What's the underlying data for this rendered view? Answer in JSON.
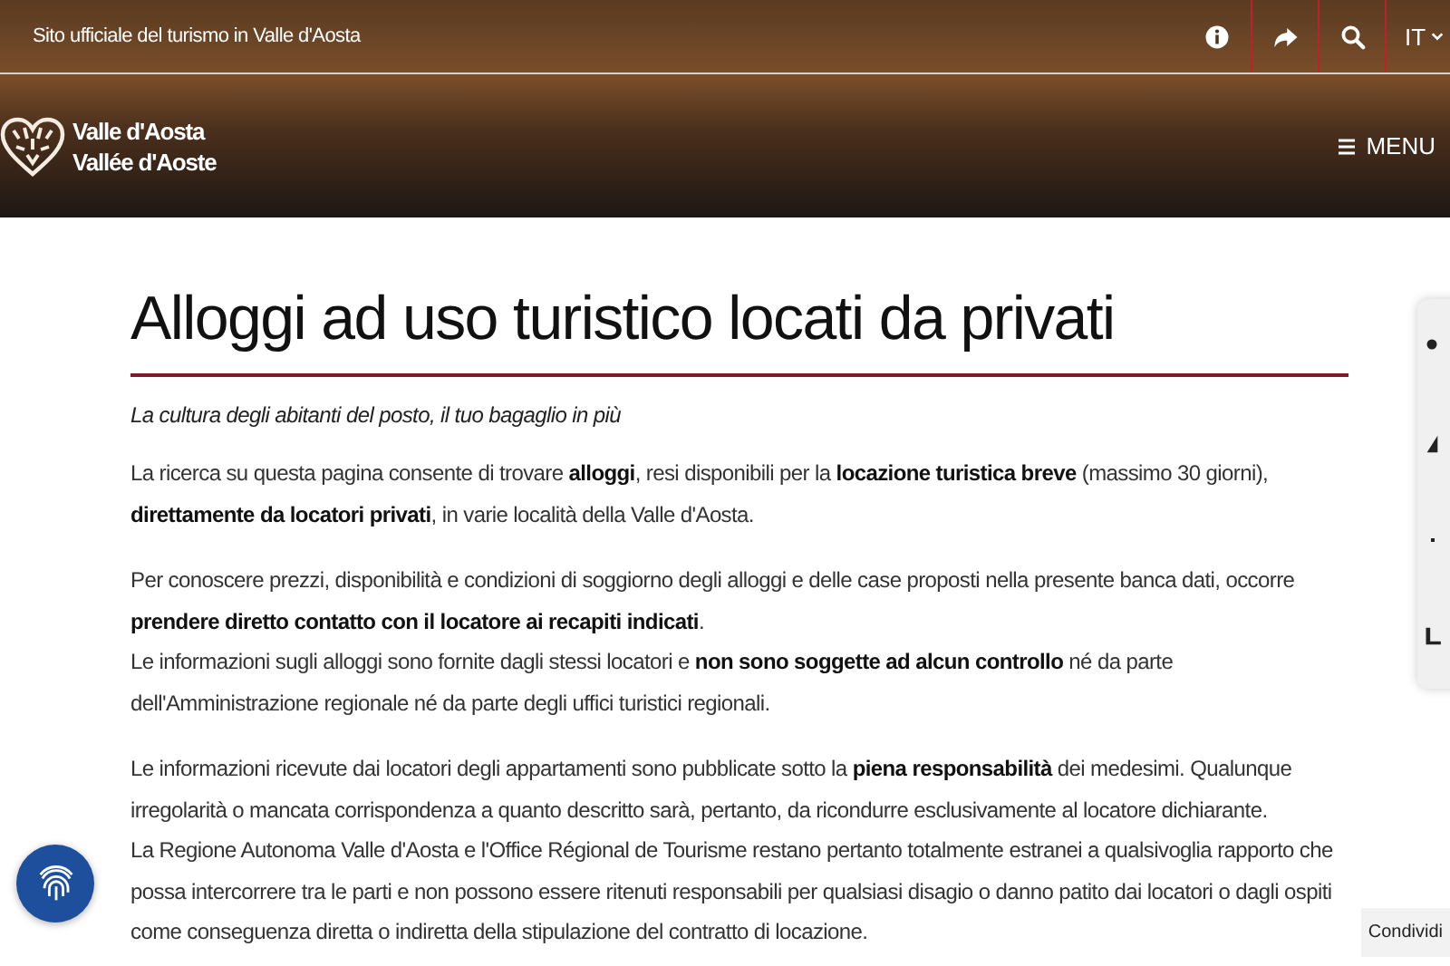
{
  "header": {
    "tagline": "Sito ufficiale del turismo in Valle d'Aosta",
    "language": "IT",
    "logo_lines": [
      "Valle d'Aosta",
      "Vallée d'Aoste"
    ],
    "menu": "MENU"
  },
  "page": {
    "title": "Alloggi ad uso turistico locati da privati",
    "subtitle": "La cultura degli abitanti del posto, il tuo bagaglio in più",
    "sections": [
      [
        "La ricerca su questa pagina consente di trovare **alloggi**, resi disponibili per la **locazione turistica breve** (massimo 30 giorni), **direttamente da locatori privati**, in varie località della Valle d'Aosta."
      ],
      [
        "Per conoscere prezzi, disponibilità e condizioni di soggiorno degli alloggi e delle case proposti nella presente banca dati, occorre **prendere diretto contatto con il locatore ai recapiti indicati**.",
        "Le informazioni sugli alloggi sono fornite dagli stessi locatori e **non sono soggette ad alcun controllo** né da parte dell'Amministrazione regionale né da parte degli uffici turistici regionali."
      ],
      [
        "Le informazioni ricevute dai locatori degli appartamenti sono pubblicate sotto la **piena responsabilità** dei medesimi. Qualunque irregolarità o mancata corrispondenza a quanto descritto sarà, pertanto, da ricondurre esclusivamente al locatore dichiarante.",
        "La Regione Autonoma Valle d'Aosta e l'Office Régional de Tourisme restano pertanto totalmente estranei a qualsivoglia rapporto che possa intercorrere tra le parti e non possono essere ritenuti responsabili per qualsiasi disagio o danno patito dai locatori o dagli ospiti come conseguenza diretta o indiretta della stipulazione del contratto di locazione."
      ]
    ]
  },
  "share_button": "Condividi"
}
